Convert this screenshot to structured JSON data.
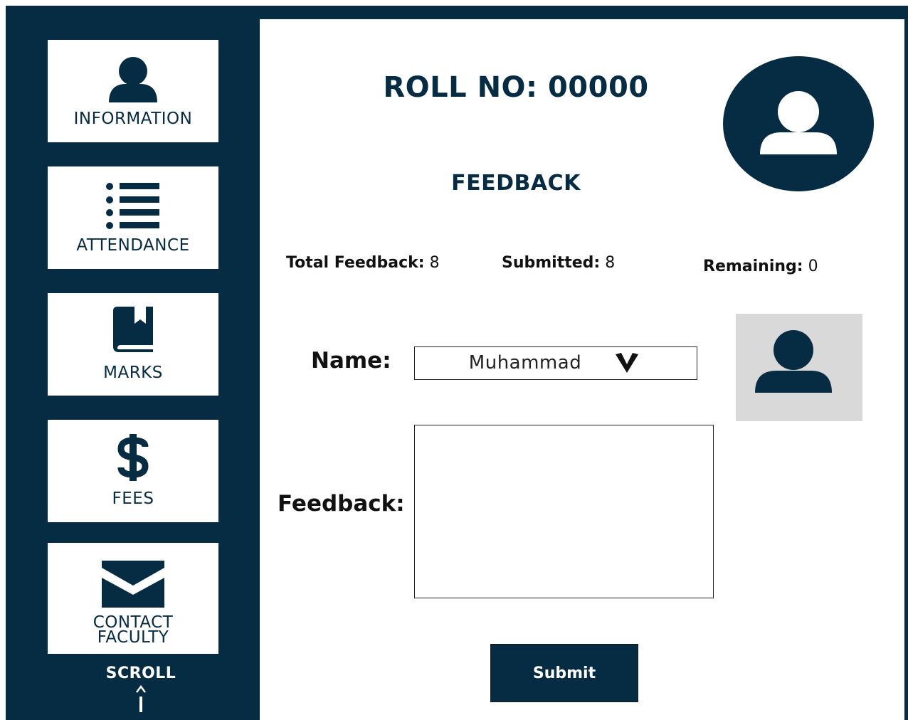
{
  "colors": {
    "primary": "#062c43",
    "background": "#ffffff",
    "photo_placeholder": "#d9d9d9"
  },
  "sidebar": {
    "items": [
      {
        "label": "INFORMATION",
        "icon": "user-icon"
      },
      {
        "label": "ATTENDANCE",
        "icon": "list-icon"
      },
      {
        "label": "MARKS",
        "icon": "book-icon"
      },
      {
        "label": "FEES",
        "icon": "dollar-icon"
      },
      {
        "label_line1": "CONTACT",
        "label_line2": "FACULTY",
        "icon": "envelope-icon"
      }
    ],
    "scroll_label": "SCROLL",
    "scroll_icon": "arrow-up-icon"
  },
  "header": {
    "roll_label": "ROLL NO: 00000",
    "section_title": "FEEDBACK",
    "profile_icon": "user-avatar-icon"
  },
  "stats": {
    "total_label": "Total Feedback:",
    "total_value": "8",
    "submitted_label": "Submitted:",
    "submitted_value": "8",
    "remaining_label": "Remaining:",
    "remaining_value": "0"
  },
  "form": {
    "name_label": "Name:",
    "name_selected": "Muhammad",
    "feedback_label": "Feedback:",
    "feedback_value": "",
    "submit_label": "Submit"
  }
}
